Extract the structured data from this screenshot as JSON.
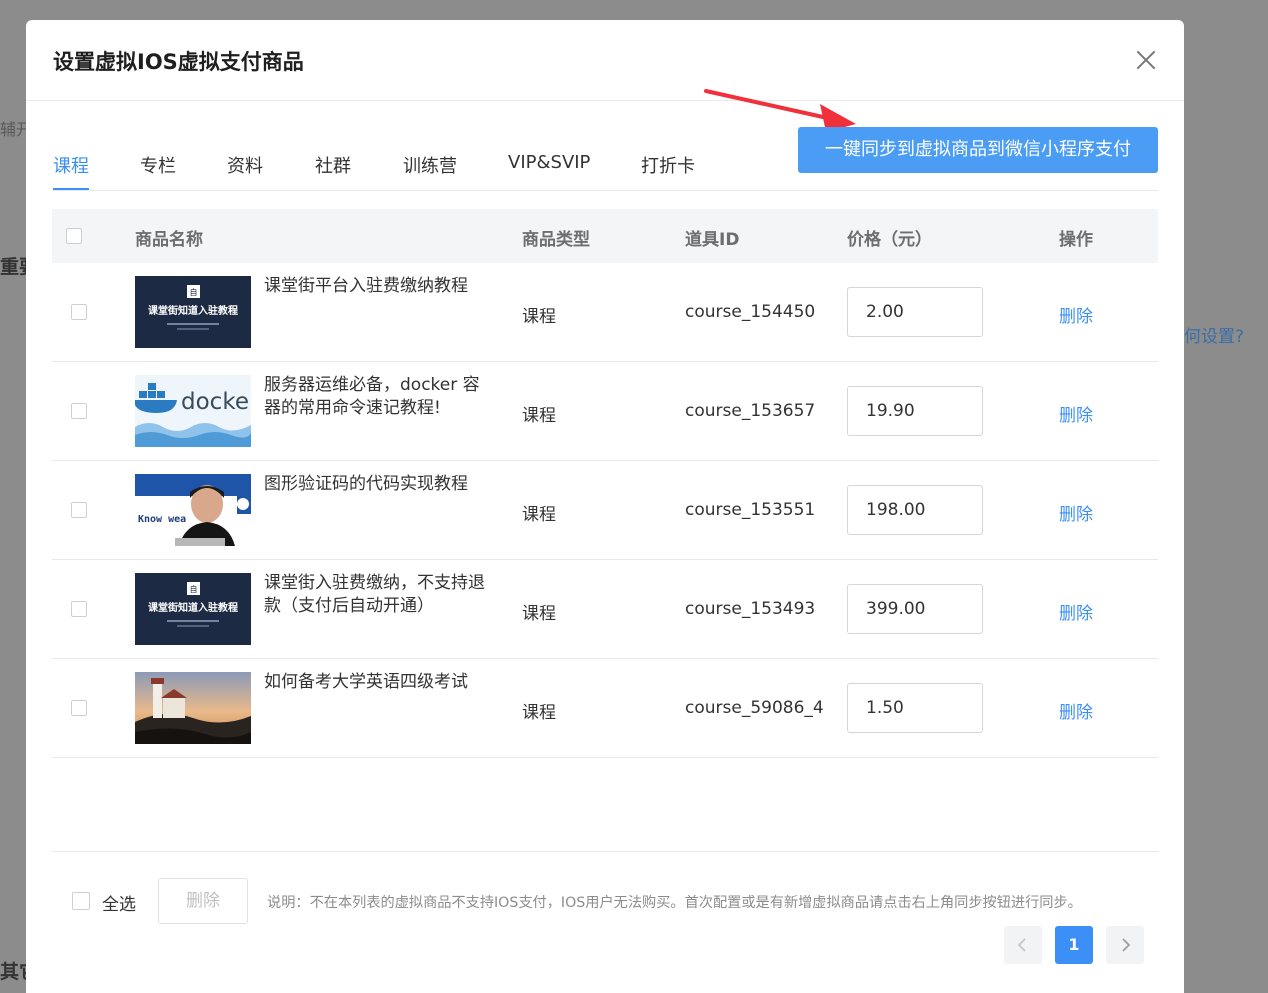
{
  "background": {
    "frag1": "辅开",
    "frag2": "重要",
    "frag3": "何设置?",
    "frag4": "其它"
  },
  "dialog": {
    "title": "设置虚拟IOS虚拟支付商品",
    "close_icon": "close-icon"
  },
  "tabs": [
    {
      "label": "课程",
      "active": true
    },
    {
      "label": "专栏"
    },
    {
      "label": "资料"
    },
    {
      "label": "社群"
    },
    {
      "label": "训练营"
    },
    {
      "label": "VIP&SVIP"
    },
    {
      "label": "打折卡"
    }
  ],
  "sync_button": "一键同步到虚拟商品到微信小程序支付",
  "table": {
    "headers": {
      "name": "商品名称",
      "type": "商品类型",
      "id": "道具ID",
      "price": "价格（元）",
      "action": "操作"
    },
    "rows": [
      {
        "name": "课堂街平台入驻费缴纳教程",
        "type": "课程",
        "id": "course_154450",
        "price": "2.00",
        "action": "删除",
        "thumb": {
          "kind": "banner",
          "text": "课堂街知道入驻教程"
        }
      },
      {
        "name": "服务器运维必备，docker 容器的常用命令速记教程!",
        "type": "课程",
        "id": "course_153657",
        "price": "19.90",
        "action": "删除",
        "thumb": {
          "kind": "docker",
          "text": "docke"
        }
      },
      {
        "name": "图形验证码的代码实现教程",
        "type": "课程",
        "id": "course_153551",
        "price": "198.00",
        "action": "删除",
        "thumb": {
          "kind": "person",
          "text": "Know wea"
        }
      },
      {
        "name": "课堂街入驻费缴纳，不支持退款（支付后自动开通）",
        "type": "课程",
        "id": "course_153493",
        "price": "399.00",
        "action": "删除",
        "thumb": {
          "kind": "banner",
          "text": "课堂街知道入驻教程"
        }
      },
      {
        "name": "如何备考大学英语四级考试",
        "type": "课程",
        "id": "course_59086_4",
        "price": "1.50",
        "action": "删除",
        "thumb": {
          "kind": "lighthouse",
          "text": ""
        }
      }
    ]
  },
  "footer": {
    "select_all": "全选",
    "bulk_delete": "删除",
    "note": "说明：不在本列表的虚拟商品不支持IOS支付，IOS用户无法购买。首次配置或是有新增虚拟商品请点击右上角同步按钮进行同步。"
  },
  "pagination": {
    "prev_icon": "chevron-left-icon",
    "current": "1",
    "next_icon": "chevron-right-icon"
  },
  "colors": {
    "accent": "#3b8ff6",
    "sync_button": "#4a9cf5",
    "annotation_arrow": "#f0303a"
  }
}
